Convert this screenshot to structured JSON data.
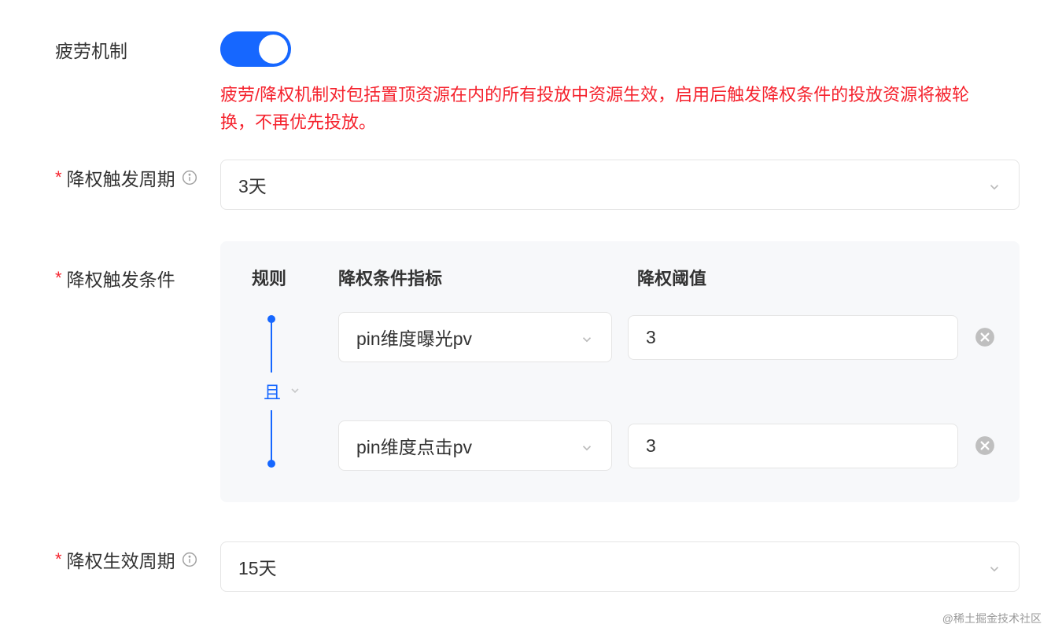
{
  "fatigue": {
    "label": "疲劳机制",
    "enabled": true,
    "warning": "疲劳/降权机制对包括置顶资源在内的所有投放中资源生效，启用后触发降权条件的投放资源将被轮换，不再优先投放。"
  },
  "triggerCycle": {
    "label": "降权触发周期",
    "value": "3天"
  },
  "triggerConditions": {
    "label": "降权触发条件",
    "headerRule": "规则",
    "headerMetric": "降权条件指标",
    "headerThreshold": "降权阈值",
    "operator": "且",
    "rows": [
      {
        "metric": "pin维度曝光pv",
        "threshold": "3"
      },
      {
        "metric": "pin维度点击pv",
        "threshold": "3"
      }
    ]
  },
  "effectCycle": {
    "label": "降权生效周期",
    "value": "15天"
  },
  "attribution": "@稀土掘金技术社区"
}
